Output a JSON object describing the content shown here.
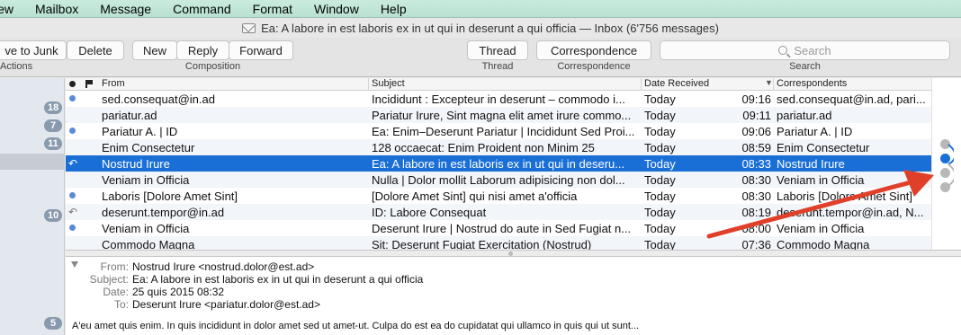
{
  "menu": [
    "iew",
    "Mailbox",
    "Message",
    "Command",
    "Format",
    "Window",
    "Help"
  ],
  "window": {
    "title": "Ea: A labore in est laboris ex in ut qui in deserunt a qui officia — Inbox (6'756 messages)"
  },
  "toolbar": {
    "junk_label": "ve to Junk",
    "delete_label": "Delete",
    "actions_label": "Actions",
    "new_label": "New",
    "reply_label": "Reply",
    "forward_label": "Forward",
    "composition_label": "Composition",
    "thread_label": "Thread",
    "thread_group_label": "Thread",
    "correspondence_label": "Correspondence",
    "correspondence_group_label": "Correspondence",
    "search_placeholder": "Search",
    "search_group_label": "Search"
  },
  "badges": [
    "18",
    "7",
    "11",
    "10"
  ],
  "columns": {
    "from": "From",
    "subject": "Subject",
    "date": "Date Received",
    "correspondents": "Correspondents"
  },
  "messages": [
    {
      "from": "sed.consequat@in.ad",
      "subject": "Incididunt : Excepteur in deserunt – commodo i...",
      "date": "Today",
      "time": "09:16",
      "corr": "sed.consequat@in.ad, pari...",
      "status": "unread"
    },
    {
      "from": "pariatur.ad",
      "subject": "Pariatur Irure, Sint magna elit amet irure commo...",
      "date": "Today",
      "time": "09:11",
      "corr": "pariatur.ad",
      "status": ""
    },
    {
      "from": "Pariatur A. | ID",
      "subject": "Ea: Enim–Deserunt Pariatur | Incididunt Sed Proi...",
      "date": "Today",
      "time": "09:06",
      "corr": "Pariatur A. | ID",
      "status": "unread"
    },
    {
      "from": "Enim Consectetur",
      "subject": "128 occaecat: Enim Proident non Minim 25",
      "date": "Today",
      "time": "08:59",
      "corr": "Enim Consectetur",
      "status": ""
    },
    {
      "from": "Nostrud Irure",
      "subject": "Ea: A labore in est laboris ex in ut qui in deseru...",
      "date": "Today",
      "time": "08:33",
      "corr": "Nostrud Irure",
      "status": "replied",
      "selected": true
    },
    {
      "from": "Veniam in Officia",
      "subject": "Nulla | Dolor mollit Laborum adipisicing non dol...",
      "date": "Today",
      "time": "08:30",
      "corr": "Veniam in Officia",
      "status": ""
    },
    {
      "from": "Laboris [Dolore Amet Sint]",
      "subject": "[Dolore Amet Sint] qui nisi amet a'officia",
      "date": "Today",
      "time": "08:30",
      "corr": "Laboris [Dolore Amet Sint]",
      "status": "unread"
    },
    {
      "from": "deserunt.tempor@in.ad",
      "subject": "ID: Labore Consequat",
      "date": "Today",
      "time": "08:19",
      "corr": "deserunt.tempor@in.ad, N...",
      "status": "replied"
    },
    {
      "from": "Veniam in Officia",
      "subject": "Deserunt Irure | Nostrud do aute in Sed Fugiat n...",
      "date": "Today",
      "time": "08:00",
      "corr": "Veniam in Officia",
      "status": "unread"
    },
    {
      "from": "Commodo Magna",
      "subject": "Sit: Deserunt Fugiat Exercitation (Nostrud)",
      "date": "Today",
      "time": "07:36",
      "corr": "Commodo Magna",
      "status": ""
    }
  ],
  "preview": {
    "from_label": "From:",
    "from": "Nostrud Irure <nostrud.dolor@est.ad>",
    "subject_label": "Subject:",
    "subject": "Ea: A labore in est laboris ex in ut qui in deserunt a qui officia",
    "date_label": "Date:",
    "date": "25 quis 2015 08:32",
    "to_label": "To:",
    "to": "Deserunt Irure <pariatur.dolor@est.ad>",
    "badge": "5",
    "body": "A'eu amet quis enim. In quis incididunt in dolor amet sed ut amet-ut. Culpa do est ea do cupidatat qui ullamco in quis qui ut sunt..."
  },
  "colors": {
    "selection": "#1a6fd6",
    "unread_dot": "#5b8ad7",
    "annotation_arrow": "#e0402a"
  }
}
